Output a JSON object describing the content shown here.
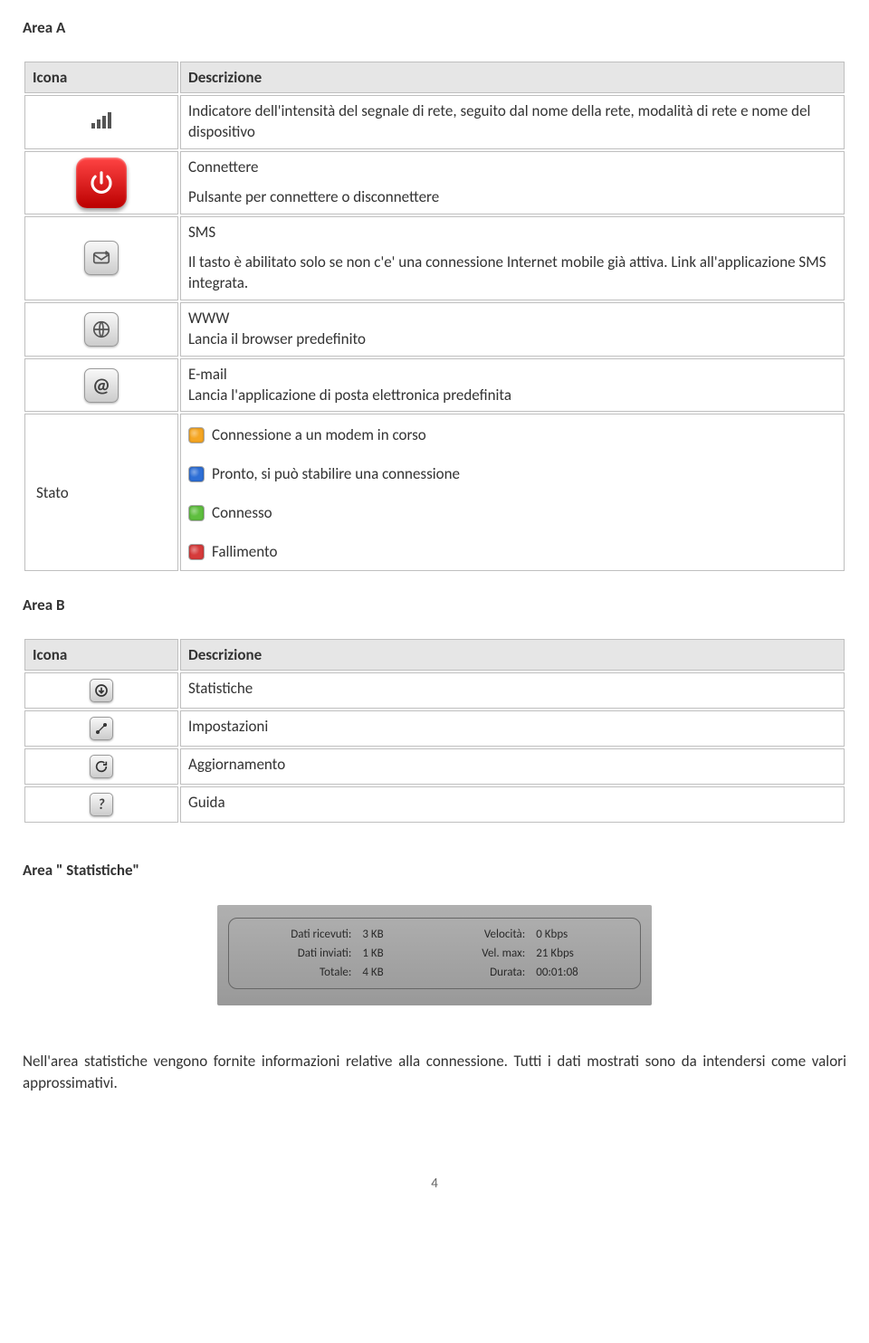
{
  "areaA": {
    "heading": "Area A",
    "columns": {
      "icon": "Icona",
      "desc": "Descrizione"
    },
    "rows": {
      "signal": {
        "desc": "Indicatore dell'intensità del segnale di rete, seguito dal nome della rete, modalità di rete e nome del dispositivo"
      },
      "connect": {
        "title": "Connettere",
        "desc": "Pulsante per connettere o disconnettere"
      },
      "sms": {
        "title": "SMS",
        "desc": "Il tasto è abilitato solo se non c'e' una connessione Internet mobile già attiva. Link all'applicazione SMS integrata."
      },
      "www": {
        "title": "WWW",
        "desc": "Lancia il browser predefinito"
      },
      "email": {
        "title": "E-mail",
        "desc": "Lancia l'applicazione di posta elettronica predefinita"
      },
      "stato": {
        "label": "Stato",
        "statuses": {
          "connecting": "Connessione a un modem in corso",
          "ready": "Pronto, si può stabilire una connessione",
          "connected": "Connesso",
          "failed": "Fallimento"
        }
      }
    }
  },
  "areaB": {
    "heading": "Area B",
    "columns": {
      "icon": "Icona",
      "desc": "Descrizione"
    },
    "rows": {
      "stats": "Statistiche",
      "settings": "Impostazioni",
      "update": "Aggiornamento",
      "help": "Guida"
    }
  },
  "areaStats": {
    "heading": "Area \" Statistiche\"",
    "panel": {
      "received_label": "Dati ricevuti:",
      "received_value": "3 KB",
      "speed_label": "Velocità:",
      "speed_value": "0 Kbps",
      "sent_label": "Dati inviati:",
      "sent_value": "1 KB",
      "maxspeed_label": "Vel. max:",
      "maxspeed_value": "21 Kbps",
      "total_label": "Totale:",
      "total_value": "4 KB",
      "duration_label": "Durata:",
      "duration_value": "00:01:08"
    },
    "body": "Nell'area statistiche vengono fornite informazioni relative alla connessione. Tutti i dati mostrati sono da intendersi come valori approssimativi."
  },
  "pageNumber": "4"
}
